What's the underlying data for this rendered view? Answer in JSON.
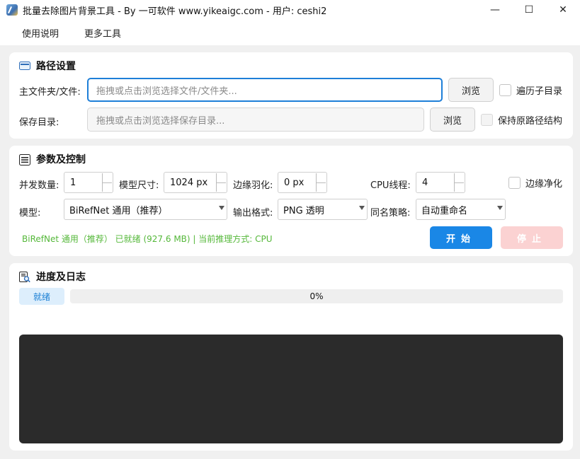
{
  "window": {
    "title": "批量去除图片背景工具 - By 一可软件 www.yikeaigc.com - 用户: ceshi2",
    "controls": {
      "minimize": "—",
      "maximize": "☐",
      "close": "✕"
    }
  },
  "menu": {
    "items": [
      "使用说明",
      "更多工具"
    ]
  },
  "path_section": {
    "title": "路径设置",
    "icon": "folder-icon",
    "main_label": "主文件夹/文件:",
    "main_placeholder": "拖拽或点击浏览选择文件/文件夹...",
    "browse_label": "浏览",
    "recurse_label": "遍历子目录",
    "recurse_checked": false,
    "save_label": "保存目录:",
    "save_placeholder": "拖拽或点击浏览选择保存目录...",
    "save_browse_label": "浏览",
    "keep_structure_label": "保持原路径结构",
    "keep_structure_checked": false
  },
  "params_section": {
    "title": "参数及控制",
    "icon": "list-icon",
    "concurrency_label": "并发数量:",
    "concurrency_value": "1",
    "model_size_label": "模型尺寸:",
    "model_size_value": "1024 px",
    "feather_label": "边缘羽化:",
    "feather_value": "0 px",
    "cpu_threads_label": "CPU线程:",
    "cpu_threads_value": "4",
    "edge_clean_label": "边缘净化",
    "edge_clean_checked": false,
    "model_label": "模型:",
    "model_value": "BiRefNet 通用（推荐）",
    "output_format_label": "输出格式:",
    "output_format_value": "PNG 透明",
    "same_name_label": "同名策略:",
    "same_name_value": "自动重命名",
    "status_text": "BiRefNet 通用（推荐） 已就绪 (927.6 MB) | 当前推理方式: CPU",
    "start_label": "开始",
    "stop_label": "停止"
  },
  "progress_section": {
    "title": "进度及日志",
    "icon": "log-search-icon",
    "state_badge": "就绪",
    "progress_percent": 0,
    "progress_text": "0%"
  },
  "colors": {
    "accent": "#1a87e6",
    "status_green": "#55b83a",
    "stop_disabled": "#fbd2d2",
    "log_bg": "#2b2b2b"
  }
}
